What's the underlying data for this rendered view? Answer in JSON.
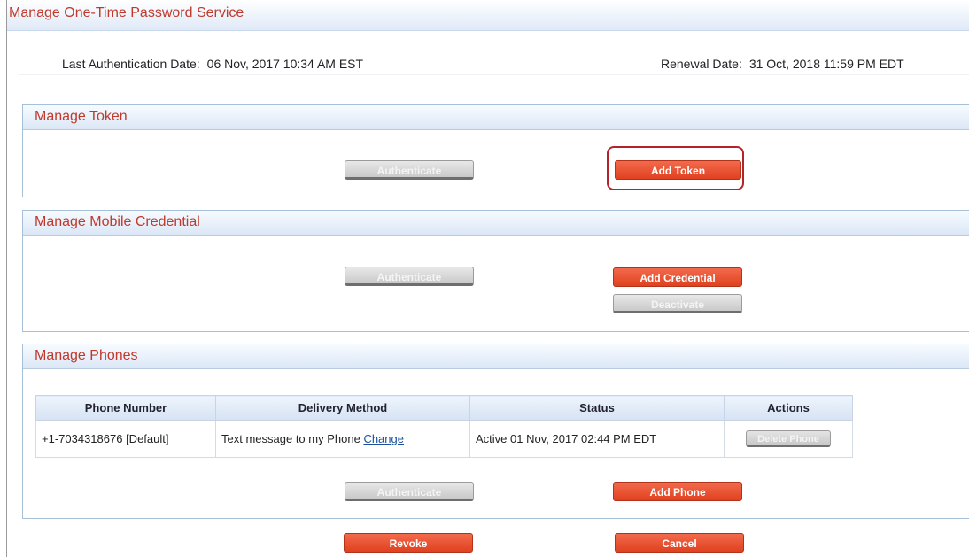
{
  "page": {
    "title": "Manage One-Time Password Service",
    "last_auth_label": "Last Authentication Date:",
    "last_auth_value": "06 Nov, 2017 10:34 AM EST",
    "renewal_label": "Renewal Date:",
    "renewal_value": "31 Oct, 2018 11:59 PM EDT"
  },
  "token": {
    "title": "Manage Token",
    "authenticate_label": "Authenticate",
    "add_label": "Add Token"
  },
  "mobile": {
    "title": "Manage Mobile Credential",
    "authenticate_label": "Authenticate",
    "add_label": "Add Credential",
    "deactivate_label": "Deactivate"
  },
  "phones": {
    "title": "Manage Phones",
    "columns": [
      "Phone Number",
      "Delivery Method",
      "Status",
      "Actions"
    ],
    "rows": [
      {
        "phone": "+1-7034318676 [Default]",
        "delivery": "Text message to my Phone",
        "change_label": "Change",
        "status": "Active 01 Nov, 2017 02:44 PM EDT",
        "action_label": "Delete Phone"
      }
    ],
    "authenticate_label": "Authenticate",
    "add_label": "Add Phone"
  },
  "footer": {
    "revoke_label": "Revoke",
    "cancel_label": "Cancel"
  },
  "colors": {
    "accent_red": "#e0411f",
    "title_red": "#c0392b",
    "highlight": "#b3242a"
  }
}
